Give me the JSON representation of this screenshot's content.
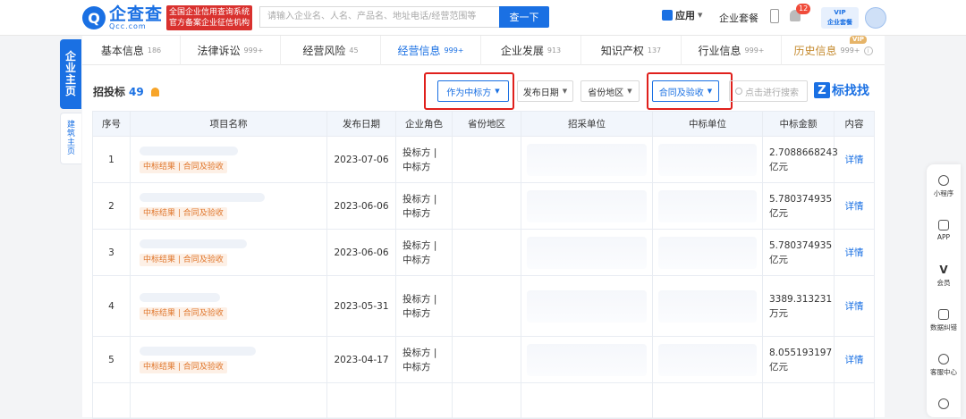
{
  "header": {
    "logo_mark": "Q",
    "logo_name": "企查查",
    "logo_domain": "Qcc.com",
    "logo_badge_line1": "全国企业信用查询系统",
    "logo_badge_line2": "官方备案企业征信机构",
    "search_placeholder": "请输入企业名、人名、产品名、地址电话/经营范围等",
    "search_button": "查一下",
    "app_label": "应用",
    "package_label": "企业套餐",
    "notif_count": "12",
    "vip_line1": "VIP",
    "vip_line2": "企业套餐"
  },
  "side_tabs": {
    "main_chars": [
      "企",
      "业",
      "主",
      "页"
    ],
    "sub_chars": [
      "建",
      "筑",
      "主",
      "页"
    ]
  },
  "tabs": [
    {
      "label": "基本信息",
      "count": "186"
    },
    {
      "label": "法律诉讼",
      "count": "999+"
    },
    {
      "label": "经营风险",
      "count": "45"
    },
    {
      "label": "经营信息",
      "count": "999+"
    },
    {
      "label": "企业发展",
      "count": "913"
    },
    {
      "label": "知识产权",
      "count": "137"
    },
    {
      "label": "行业信息",
      "count": "999+"
    },
    {
      "label": "历史信息",
      "count": "999+"
    }
  ],
  "history_vip_tag": "VIP",
  "section": {
    "title": "招投标",
    "count": "49"
  },
  "filters": {
    "role": "作为中标方",
    "date": "发布日期",
    "region": "省份地区",
    "type": "合同及验收",
    "search_placeholder": "点击进行搜索",
    "brand_mark": "Z",
    "brand_label": "标找找"
  },
  "table": {
    "headers": [
      "序号",
      "项目名称",
      "发布日期",
      "企业角色",
      "省份地区",
      "招采单位",
      "中标单位",
      "中标金额",
      "内容"
    ],
    "rows": [
      {
        "index": "1",
        "tag": "中标结果 | 合同及验收",
        "date": "2023-07-06",
        "role1": "投标方 |",
        "role2": "中标方",
        "amt1": "2.7088668243",
        "amt2": "亿元",
        "detail": "详情"
      },
      {
        "index": "2",
        "tag": "中标结果 | 合同及验收",
        "date": "2023-06-06",
        "role1": "投标方 |",
        "role2": "中标方",
        "amt1": "5.780374935",
        "amt2": "亿元",
        "detail": "详情"
      },
      {
        "index": "3",
        "tag": "中标结果 | 合同及验收",
        "date": "2023-06-06",
        "role1": "投标方 |",
        "role2": "中标方",
        "amt1": "5.780374935",
        "amt2": "亿元",
        "detail": "详情"
      },
      {
        "index": "4",
        "tag": "中标结果 | 合同及验收",
        "date": "2023-05-31",
        "role1": "投标方 |",
        "role2": "中标方",
        "amt1": "3389.313231",
        "amt2": "万元",
        "detail": "详情"
      },
      {
        "index": "5",
        "tag": "中标结果 | 合同及验收",
        "date": "2023-04-17",
        "role1": "投标方 |",
        "role2": "中标方",
        "amt1": "8.055193197",
        "amt2": "亿元",
        "detail": "详情"
      }
    ]
  },
  "right_bar": [
    {
      "label": "小程序",
      "icon": "mini-program-icon"
    },
    {
      "label": "APP",
      "icon": "phone-icon"
    },
    {
      "label": "会员",
      "icon": "vip-icon"
    },
    {
      "label": "数据纠错",
      "icon": "edit-icon"
    },
    {
      "label": "客服中心",
      "icon": "headset-icon"
    },
    {
      "label": "",
      "icon": "chat-icon"
    }
  ],
  "colors": {
    "accent": "#1a70e3",
    "highlight_box": "#e0201c",
    "tag_orange": "#e0772d"
  }
}
